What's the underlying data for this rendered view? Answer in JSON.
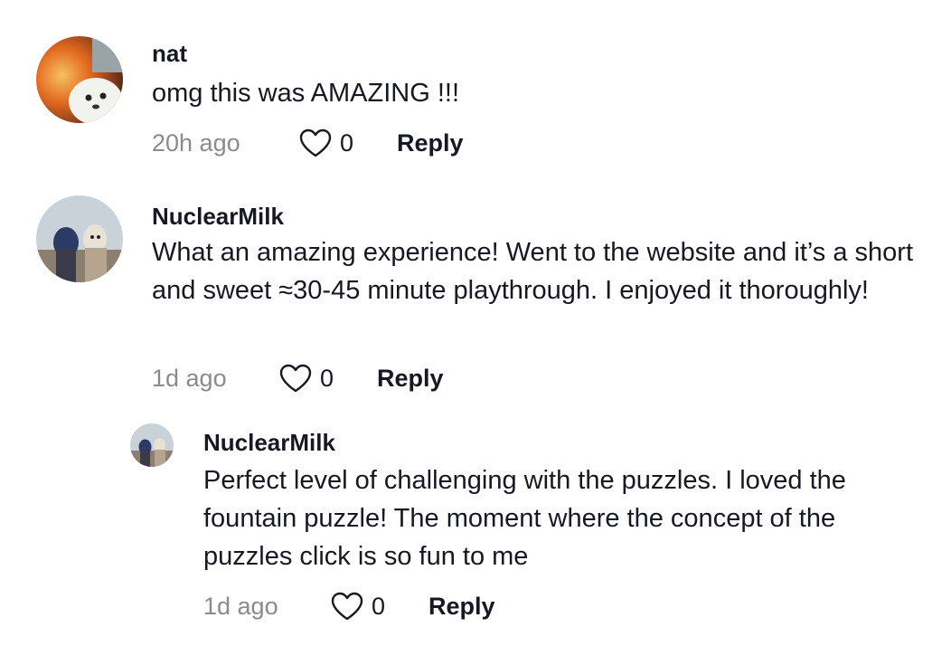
{
  "comments": [
    {
      "username": "nat",
      "text": "omg this was AMAZING !!!",
      "time": "20h ago",
      "likes": "0",
      "reply_label": "Reply"
    },
    {
      "username": "NuclearMilk",
      "text": "What an amazing experience! Went to the website and it’s a short and sweet ≈30-45 minute playthrough. I enjoyed it thoroughly!",
      "time": "1d ago",
      "likes": "0",
      "reply_label": "Reply"
    },
    {
      "username": "NuclearMilk",
      "text": "Perfect level of challenging with the puzzles. I loved the fountain puzzle! The moment where the concept of the puzzles click is so fun to me",
      "time": "1d ago",
      "likes": "0",
      "reply_label": "Reply"
    }
  ],
  "icons": {
    "like": "heart-outline-icon"
  },
  "colors": {
    "text": "#161823",
    "muted": "#8a8b91",
    "background": "#ffffff"
  }
}
